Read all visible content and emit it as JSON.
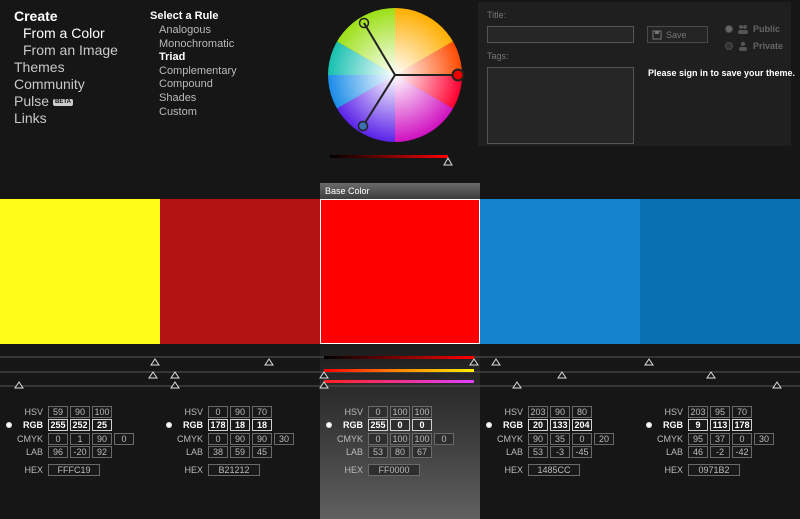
{
  "nav": {
    "create": "Create",
    "from_color": "From a Color",
    "from_image": "From an Image",
    "themes": "Themes",
    "community": "Community",
    "pulse": "Pulse",
    "beta": "BETA",
    "links": "Links"
  },
  "rules": {
    "title": "Select a Rule",
    "items": [
      "Analogous",
      "Monochromatic",
      "Triad",
      "Complementary",
      "Compound",
      "Shades",
      "Custom"
    ],
    "selected": "Triad"
  },
  "save_panel": {
    "title_label": "Title:",
    "title_value": "",
    "tags_label": "Tags:",
    "tags_value": "",
    "save_button": "Save",
    "public_label": "Public",
    "private_label": "Private",
    "sign_in_message": "Please sign in to save your theme."
  },
  "base_color_label": "Base Color",
  "labels": {
    "hsv": "HSV",
    "rgb": "RGB",
    "cmyk": "CMYK",
    "lab": "LAB",
    "hex": "HEX"
  },
  "swatches": [
    {
      "color": "#FFFC19",
      "hsv": [
        "59",
        "90",
        "100"
      ],
      "rgb": [
        "255",
        "252",
        "25"
      ],
      "cmyk": [
        "0",
        "1",
        "90",
        "0"
      ],
      "lab": [
        "96",
        "-20",
        "92"
      ],
      "hex": "FFFC19"
    },
    {
      "color": "#B21212",
      "hsv": [
        "0",
        "90",
        "70"
      ],
      "rgb": [
        "178",
        "18",
        "18"
      ],
      "cmyk": [
        "0",
        "90",
        "90",
        "30"
      ],
      "lab": [
        "38",
        "59",
        "45"
      ],
      "hex": "B21212"
    },
    {
      "color": "#FF0000",
      "hsv": [
        "0",
        "100",
        "100"
      ],
      "rgb": [
        "255",
        "0",
        "0"
      ],
      "cmyk": [
        "0",
        "100",
        "100",
        "0"
      ],
      "lab": [
        "53",
        "80",
        "67"
      ],
      "hex": "FF0000",
      "base": true
    },
    {
      "color": "#1485CC",
      "hsv": [
        "203",
        "90",
        "80"
      ],
      "rgb": [
        "20",
        "133",
        "204"
      ],
      "cmyk": [
        "90",
        "35",
        "0",
        "20"
      ],
      "lab": [
        "53",
        "-3",
        "-45"
      ],
      "hex": "1485CC"
    },
    {
      "color": "#0971B2",
      "hsv": [
        "203",
        "95",
        "70"
      ],
      "rgb": [
        "9",
        "113",
        "178"
      ],
      "cmyk": [
        "95",
        "37",
        "0",
        "30"
      ],
      "lab": [
        "46",
        "-2",
        "-42"
      ],
      "hex": "0971B2"
    }
  ],
  "colors": {
    "background": "#161616",
    "panel": "#1f1f1f",
    "accent": "#FF0000"
  }
}
